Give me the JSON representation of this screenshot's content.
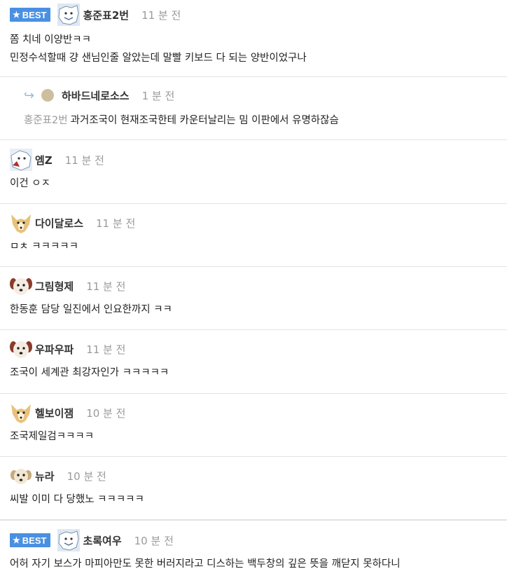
{
  "best_label": "BEST",
  "comments": [
    {
      "nickname": "홍준표2번",
      "time": "11 분 전",
      "lines": [
        "쫌 치네 이양반ㅋㅋ",
        "민정수석할때 걍 샌님인줄 알았는데 말빨 키보드 다 되는 양반이었구나"
      ],
      "best": true
    },
    {
      "nickname": "하바드네로소스",
      "time": "1 분 전",
      "mention": "홍준표2번",
      "lines": [
        "과거조국이 현재조국한테 카운터날리는 밈 이판에서 유명하잖슴"
      ],
      "reply": true
    },
    {
      "nickname": "엠Z",
      "time": "11 분 전",
      "lines": [
        "이건 ㅇㅈ"
      ]
    },
    {
      "nickname": "다이달로스",
      "time": "11 분 전",
      "lines": [
        "ㅁㅊ ㅋㅋㅋㅋㅋ"
      ]
    },
    {
      "nickname": "그림형제",
      "time": "11 분 전",
      "lines": [
        "한동훈 담당 일진에서 인요한까지 ㅋㅋ"
      ]
    },
    {
      "nickname": "우파우파",
      "time": "11 분 전",
      "lines": [
        "조국이 세계관 최강자인가 ㅋㅋㅋㅋㅋ"
      ]
    },
    {
      "nickname": "헬보이잼",
      "time": "10 분 전",
      "lines": [
        "조국제일검ㅋㅋㅋㅋ"
      ]
    },
    {
      "nickname": "뉴라",
      "time": "10 분 전",
      "lines": [
        "씨발 이미 다 당했노 ㅋㅋㅋㅋㅋ"
      ]
    },
    {
      "nickname": "초록여우",
      "time": "10 분 전",
      "lines": [
        "어허 자기 보스가 마피아만도 못한 버러지라고 디스하는 백두창의 깊은 뜻을 깨닫지 못하다니"
      ],
      "best": true
    }
  ],
  "colors": {
    "best_badge": "#4a90e2",
    "nickname": "#333333",
    "time": "#9a9a9a",
    "divider": "#e3e3e3"
  },
  "icons": {
    "best": "star-icon",
    "reply": "reply-arrow-icon",
    "avatar": "user-avatar-icon"
  }
}
